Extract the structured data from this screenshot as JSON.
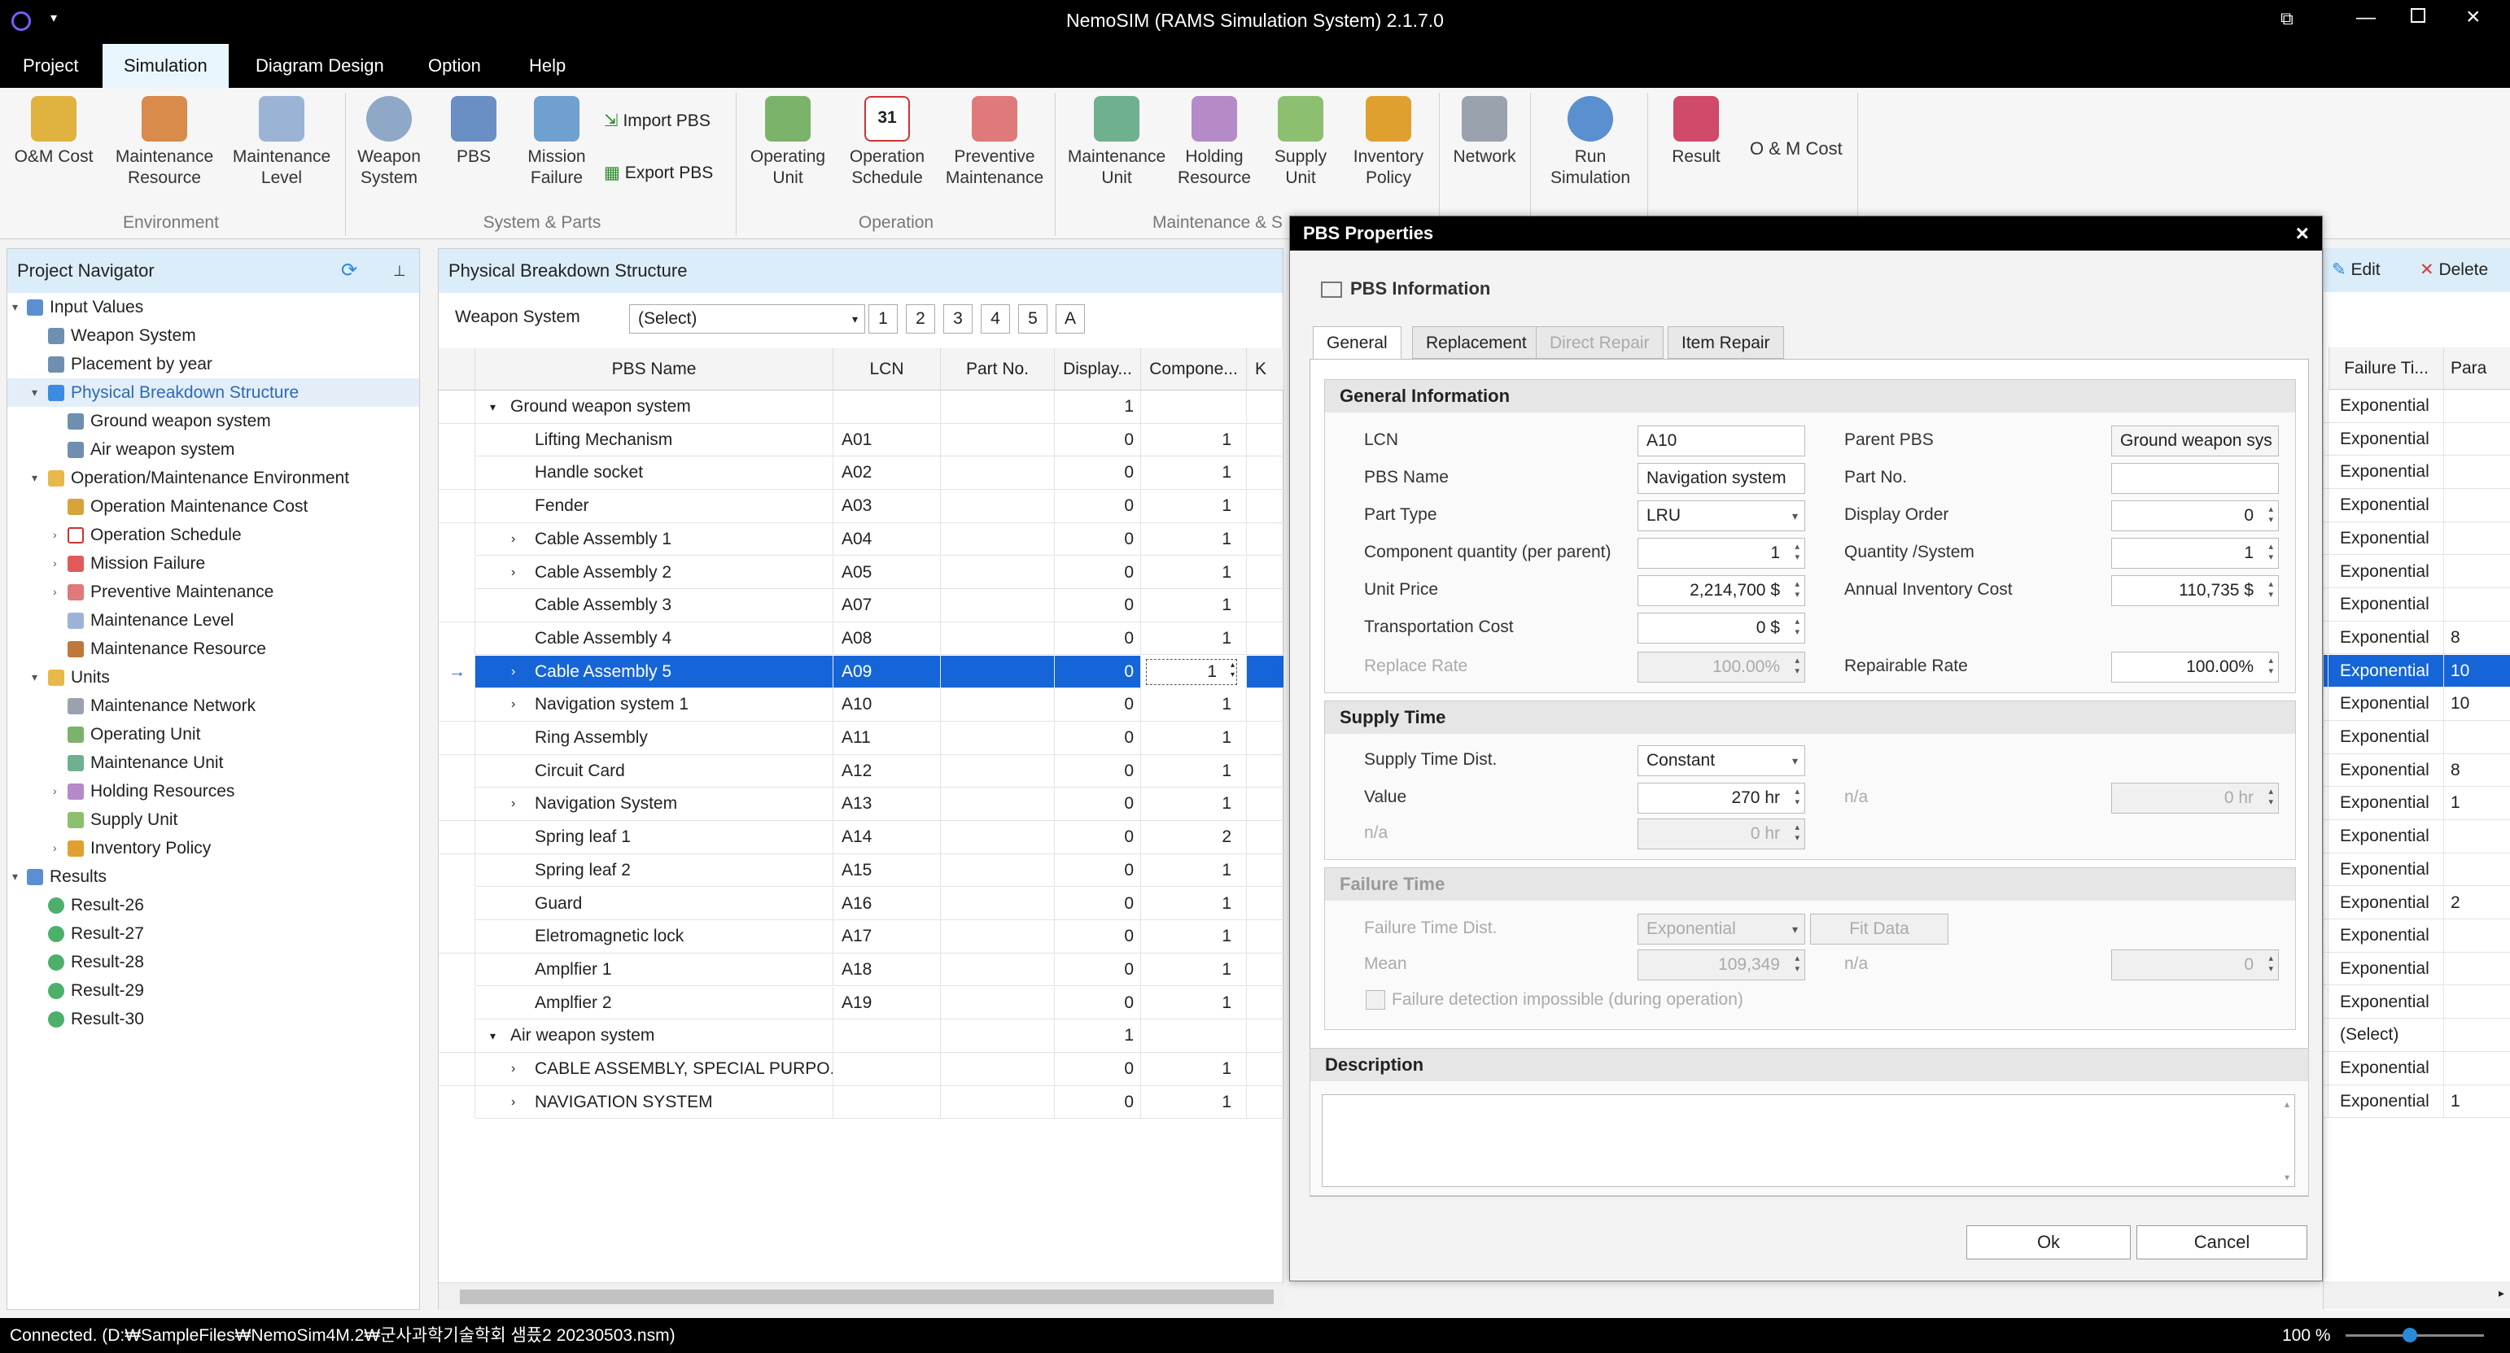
{
  "window": {
    "title": "NemoSIM (RAMS Simulation System) 2.1.7.0"
  },
  "menu": [
    "Project",
    "Simulation",
    "Diagram Design",
    "Option",
    "Help"
  ],
  "ribbon": {
    "buttons": [
      {
        "l1": "O&M Cost",
        "l2": ""
      },
      {
        "l1": "Maintenance",
        "l2": "Resource"
      },
      {
        "l1": "Maintenance",
        "l2": "Level"
      },
      {
        "l1": "Weapon",
        "l2": "System"
      },
      {
        "l1": "PBS",
        "l2": ""
      },
      {
        "l1": "Mission",
        "l2": "Failure"
      },
      {
        "l1": "Operating",
        "l2": "Unit"
      },
      {
        "l1": "Operation",
        "l2": "Schedule"
      },
      {
        "l1": "Preventive",
        "l2": "Maintenance"
      },
      {
        "l1": "Maintenance",
        "l2": "Unit"
      },
      {
        "l1": "Holding",
        "l2": "Resource"
      },
      {
        "l1": "Supply",
        "l2": "Unit"
      },
      {
        "l1": "Inventory",
        "l2": "Policy"
      },
      {
        "l1": "Network",
        "l2": ""
      },
      {
        "l1": "Run",
        "l2": "Simulation"
      },
      {
        "l1": "Result",
        "l2": ""
      }
    ],
    "import_pbs": "Import PBS",
    "export_pbs": "Export PBS",
    "om_cost": "O & M Cost",
    "groups": [
      "Environment",
      "System & Parts",
      "Operation",
      "Maintenance & S"
    ]
  },
  "navigator": {
    "title": "Project Navigator",
    "items": [
      "Input Values",
      "Weapon System",
      "Placement by year",
      "Physical Breakdown Structure",
      "Ground weapon system",
      "Air weapon system",
      "Operation/Maintenance Environment",
      "Operation Maintenance Cost",
      "Operation Schedule",
      "Mission Failure",
      "Preventive Maintenance",
      "Maintenance Level",
      "Maintenance Resource",
      "Units",
      "Maintenance Network",
      "Operating Unit",
      "Maintenance Unit",
      "Holding Resources",
      "Supply Unit",
      "Inventory Policy",
      "Results",
      "Result-26",
      "Result-27",
      "Result-28",
      "Result-29",
      "Result-30"
    ]
  },
  "pbs": {
    "title": "Physical Breakdown Structure",
    "weapon_label": "Weapon System",
    "weapon_select": "(Select)",
    "levels": [
      "1",
      "2",
      "3",
      "4",
      "5",
      "A"
    ],
    "columns": [
      "PBS Name",
      "LCN",
      "Part No.",
      "Display...",
      "Compone...",
      "K Va"
    ],
    "rows": [
      [
        "Ground weapon system",
        "",
        "",
        "1",
        ""
      ],
      [
        "Lifting Mechanism",
        "A01",
        "",
        "0",
        "1"
      ],
      [
        "Handle socket",
        "A02",
        "",
        "0",
        "1"
      ],
      [
        "Fender",
        "A03",
        "",
        "0",
        "1"
      ],
      [
        "Cable Assembly 1",
        "A04",
        "",
        "0",
        "1"
      ],
      [
        "Cable Assembly 2",
        "A05",
        "",
        "0",
        "1"
      ],
      [
        "Cable Assembly 3",
        "A07",
        "",
        "0",
        "1"
      ],
      [
        "Cable Assembly 4",
        "A08",
        "",
        "0",
        "1"
      ],
      [
        "Cable Assembly 5",
        "A09",
        "",
        "0",
        "1"
      ],
      [
        "Navigation system 1",
        "A10",
        "",
        "0",
        "1"
      ],
      [
        "Ring Assembly",
        "A11",
        "",
        "0",
        "1"
      ],
      [
        "Circuit Card",
        "A12",
        "",
        "0",
        "1"
      ],
      [
        "Navigation System",
        "A13",
        "",
        "0",
        "1"
      ],
      [
        "Spring leaf 1",
        "A14",
        "",
        "0",
        "2"
      ],
      [
        "Spring leaf 2",
        "A15",
        "",
        "0",
        "1"
      ],
      [
        "Guard",
        "A16",
        "",
        "0",
        "1"
      ],
      [
        "Eletromagnetic lock",
        "A17",
        "",
        "0",
        "1"
      ],
      [
        "Amplfier 1",
        "A18",
        "",
        "0",
        "1"
      ],
      [
        "Amplfier 2",
        "A19",
        "",
        "0",
        "1"
      ],
      [
        "Air weapon system",
        "",
        "",
        "1",
        ""
      ],
      [
        "CABLE ASSEMBLY, SPECIAL PURPO...",
        "",
        "",
        "0",
        "1"
      ],
      [
        "NAVIGATION SYSTEM",
        "",
        "",
        "0",
        "1"
      ]
    ]
  },
  "right": {
    "edit": "Edit",
    "delete": "Delete",
    "col1": "Failure Ti...",
    "col2": "Para",
    "rows": [
      [
        "Exponential",
        ""
      ],
      [
        "Exponential",
        ""
      ],
      [
        "Exponential",
        ""
      ],
      [
        "Exponential",
        ""
      ],
      [
        "Exponential",
        ""
      ],
      [
        "Exponential",
        ""
      ],
      [
        "Exponential",
        ""
      ],
      [
        "Exponential",
        "8"
      ],
      [
        "Exponential",
        "10"
      ],
      [
        "Exponential",
        "10"
      ],
      [
        "Exponential",
        ""
      ],
      [
        "Exponential",
        "8"
      ],
      [
        "Exponential",
        "1"
      ],
      [
        "Exponential",
        ""
      ],
      [
        "Exponential",
        ""
      ],
      [
        "Exponential",
        "2"
      ],
      [
        "Exponential",
        ""
      ],
      [
        "Exponential",
        ""
      ],
      [
        "Exponential",
        ""
      ],
      [
        "(Select)",
        ""
      ],
      [
        "Exponential",
        ""
      ],
      [
        "Exponential",
        "1"
      ]
    ]
  },
  "dialog": {
    "title": "PBS Properties",
    "info": "PBS Information",
    "tabs": [
      "General",
      "Replacement",
      "Direct Repair",
      "Item Repair"
    ],
    "general": {
      "header": "General Information",
      "lcn_l": "LCN",
      "lcn": "A10",
      "parent_l": "Parent PBS",
      "parent": "Ground weapon sys",
      "name_l": "PBS Name",
      "name": "Navigation system",
      "partno_l": "Part No.",
      "partno": "",
      "type_l": "Part Type",
      "type": "LRU",
      "order_l": "Display Order",
      "order": "0",
      "comp_l": "Component quantity (per parent)",
      "comp": "1",
      "qty_l": "Quantity /System",
      "qty": "1",
      "price_l": "Unit Price",
      "price": "2,214,700 $",
      "annual_l": "Annual Inventory Cost",
      "annual": "110,735 $",
      "trans_l": "Transportation Cost",
      "trans": "0 $",
      "replace_l": "Replace Rate",
      "replace": "100.00%",
      "repair_l": "Repairable Rate",
      "repair": "100.00%"
    },
    "supply": {
      "header": "Supply Time",
      "dist_l": "Supply Time Dist.",
      "dist": "Constant",
      "value_l": "Value",
      "value": "270 hr",
      "na1": "n/a",
      "na1v": "0 hr",
      "na2": "n/a",
      "na2v": "0 hr"
    },
    "failure": {
      "header": "Failure Time",
      "dist_l": "Failure Time Dist.",
      "dist": "Exponential",
      "fit": "Fit Data",
      "mean_l": "Mean",
      "mean": "109,349",
      "na": "n/a",
      "nav": "0",
      "check": "Failure detection impossible (during operation)"
    },
    "desc": "Description",
    "ok": "Ok",
    "cancel": "Cancel"
  },
  "status": {
    "text": "Connected. (D:₩SampleFiles₩NemoSim4M.2₩군사과학기술학회 샘픘2 20230503.nsm)",
    "zoom": "100 %"
  }
}
